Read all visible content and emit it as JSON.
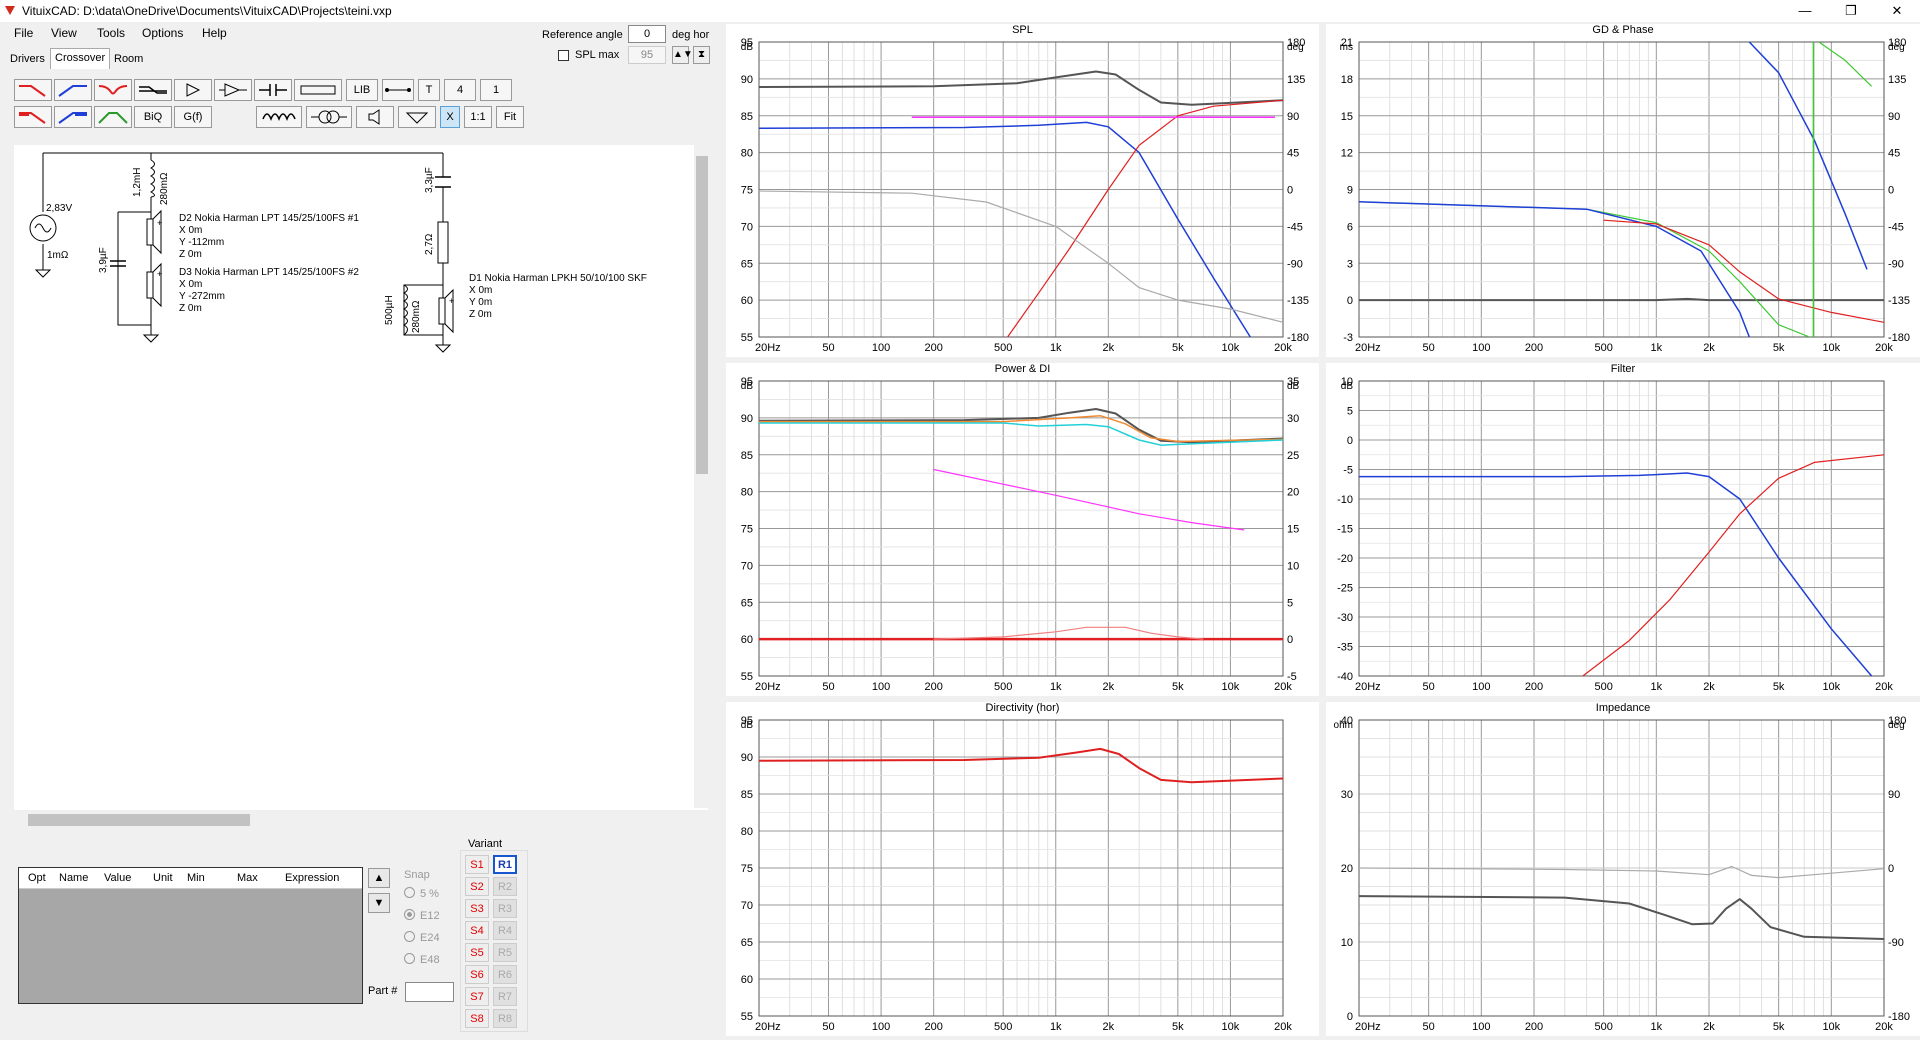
{
  "window": {
    "title": "VituixCAD: D:\\data\\OneDrive\\Documents\\VituixCAD\\Projects\\teini.vxp",
    "minimize": "—",
    "maximize": "❐",
    "close": "✕"
  },
  "menu": [
    "File",
    "View",
    "Tools",
    "Options",
    "Help"
  ],
  "tabs": [
    "Drivers",
    "Crossover",
    "Room"
  ],
  "reference": {
    "label": "Reference angle",
    "value": "0",
    "unit": "deg hor",
    "spl_max_label": "SPL max",
    "spl_max_value": "95"
  },
  "toolbar": {
    "lib": "LIB",
    "t": "T",
    "four": "4",
    "one": "1",
    "biq": "BiQ",
    "gf": "G(f)",
    "x": "X",
    "ratio": "1:1",
    "fit": "Fit"
  },
  "schematic": {
    "source_voltage": "2,83V",
    "source_res": "1mΩ",
    "l1": "1,2mH",
    "l1_r": "280mΩ",
    "c1": "3,9µF",
    "c2": "3,3µF",
    "r1": "2,7Ω",
    "l2": "500µH",
    "l2_r": "280mΩ",
    "d2": {
      "name": "D2 Nokia Harman LPT 145/25/100FS #1",
      "x": "X 0m",
      "y": "Y -112mm",
      "z": "Z 0m"
    },
    "d3": {
      "name": "D3 Nokia Harman LPT 145/25/100FS #2",
      "x": "X 0m",
      "y": "Y -272mm",
      "z": "Z 0m"
    },
    "d1": {
      "name": "D1 Nokia Harman LPKH 50/10/100 SKF",
      "x": "X 0m",
      "y": "Y 0m",
      "z": "Z 0m"
    }
  },
  "table_headers": [
    "Opt",
    "Name",
    "Value",
    "Unit",
    "Min",
    "Max",
    "Expression"
  ],
  "snap": {
    "label": "Snap",
    "options": [
      "5 %",
      "E12",
      "E24",
      "E48"
    ],
    "part_label": "Part #"
  },
  "variant": {
    "label": "Variant",
    "s": [
      "S1",
      "S2",
      "S3",
      "S4",
      "S5",
      "S6",
      "S7",
      "S8"
    ],
    "r": [
      "R1",
      "R2",
      "R3",
      "R4",
      "R5",
      "R6",
      "R7",
      "R8"
    ]
  },
  "x_ticks": [
    "20Hz",
    "50",
    "100",
    "200",
    "500",
    "1k",
    "2k",
    "5k",
    "10k",
    "20k"
  ],
  "charts": {
    "spl": {
      "title": "SPL",
      "left_unit": "dB",
      "right_unit": "deg",
      "left_ticks": [
        "95",
        "90",
        "85",
        "80",
        "75",
        "70",
        "65",
        "60",
        "55"
      ],
      "right_ticks": [
        "180",
        "135",
        "90",
        "45",
        "0",
        "-45",
        "-90",
        "-135",
        "-180"
      ]
    },
    "gd": {
      "title": "GD & Phase",
      "left_unit": "ms",
      "right_unit": "deg",
      "left_ticks": [
        "21",
        "18",
        "15",
        "12",
        "9",
        "6",
        "3",
        "0",
        "-3"
      ],
      "right_ticks": [
        "180",
        "135",
        "90",
        "45",
        "0",
        "-45",
        "-90",
        "-135",
        "-180"
      ]
    },
    "power": {
      "title": "Power & DI",
      "left_unit": "dB",
      "right_unit": "dB",
      "left_ticks": [
        "95",
        "90",
        "85",
        "80",
        "75",
        "70",
        "65",
        "60",
        "55"
      ],
      "right_ticks": [
        "35",
        "30",
        "25",
        "20",
        "15",
        "10",
        "5",
        "0",
        "-5"
      ]
    },
    "filter": {
      "title": "Filter",
      "left_unit": "dB",
      "right_unit": "",
      "left_ticks": [
        "10",
        "5",
        "0",
        "-5",
        "-10",
        "-15",
        "-20",
        "-25",
        "-30",
        "-35",
        "-40"
      ],
      "right_ticks": []
    },
    "directivity": {
      "title": "Directivity (hor)",
      "left_unit": "dB",
      "right_unit": "",
      "left_ticks": [
        "95",
        "90",
        "85",
        "80",
        "75",
        "70",
        "65",
        "60",
        "55"
      ],
      "right_ticks": []
    },
    "impedance": {
      "title": "Impedance",
      "left_unit": "ohm",
      "right_unit": "deg",
      "left_ticks": [
        "40",
        "30",
        "20",
        "10",
        "0"
      ],
      "right_ticks": [
        "180",
        "90",
        "0",
        "-90",
        "-180"
      ]
    }
  },
  "colors": {
    "red": "#e02020",
    "blue": "#1f3fd6",
    "green": "#3ec832",
    "magenta": "#ff33ff",
    "dark": "#555555",
    "gray": "#aaaaaa",
    "cyan": "#22d0d8",
    "orange": "#f08a30"
  }
}
